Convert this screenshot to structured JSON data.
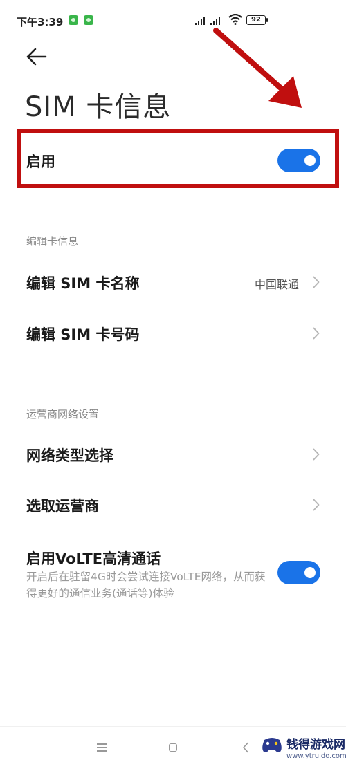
{
  "status_bar": {
    "time": "下午3:39",
    "battery": "92"
  },
  "header": {
    "title": "SIM 卡信息"
  },
  "enable_row": {
    "label": "启用",
    "enabled": true
  },
  "edit_section": {
    "header": "编辑卡信息",
    "items": [
      {
        "label": "编辑 SIM 卡名称",
        "value": "中国联通"
      },
      {
        "label": "编辑 SIM 卡号码",
        "value": ""
      }
    ]
  },
  "carrier_section": {
    "header": "运营商网络设置",
    "items": [
      {
        "label": "网络类型选择"
      },
      {
        "label": "选取运营商"
      }
    ],
    "volte": {
      "label": "启用VoLTE高清通话",
      "description": "开启后在驻留4G时会尝试连接VoLTE网络，从而获得更好的通信业务(通话等)体验",
      "enabled": true
    }
  },
  "watermark": {
    "title": "钱得游戏网",
    "url": "www.ytruido.com"
  },
  "colors": {
    "accent": "#1a73e8",
    "annotation": "#c00f0f"
  },
  "icons": [
    "back-arrow-icon",
    "chevron-right-icon",
    "wifi-icon",
    "signal-icon",
    "battery-icon",
    "menu-icon",
    "home-icon",
    "back-icon"
  ]
}
